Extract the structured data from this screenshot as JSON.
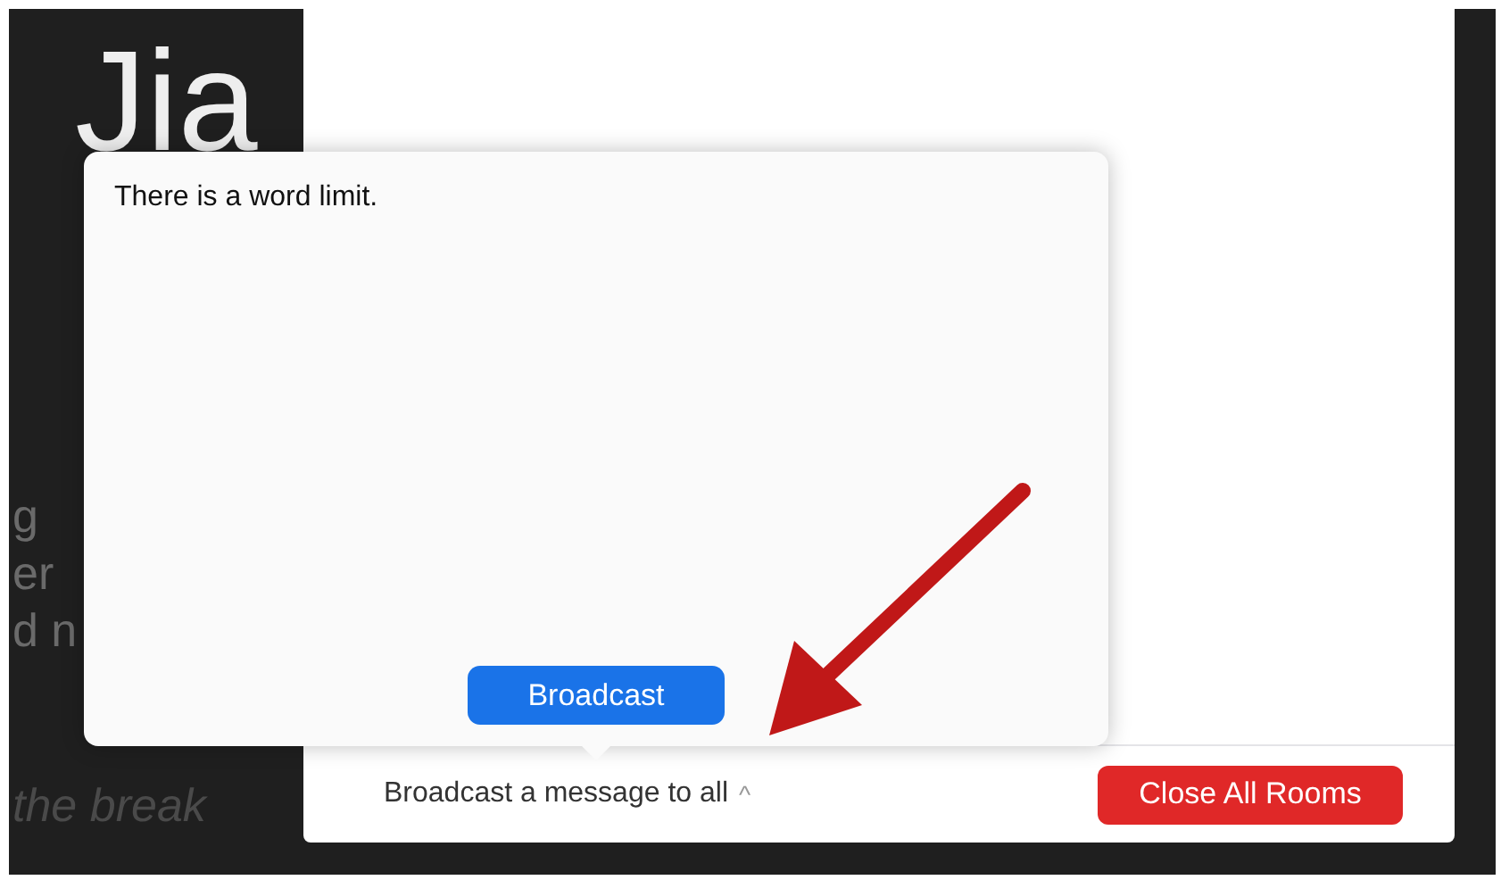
{
  "background_texts": [
    {
      "kind": "heading",
      "text": "Jia"
    },
    {
      "kind": "line",
      "text": "g"
    },
    {
      "kind": "line",
      "text": "er"
    },
    {
      "kind": "line",
      "text": "d n"
    },
    {
      "kind": "italic",
      "text": "the break"
    }
  ],
  "popover": {
    "message": "There is a word limit.",
    "button": "Broadcast"
  },
  "bottom_bar": {
    "label": "Broadcast a message to all",
    "caret": "^",
    "close_button": "Close All Rooms"
  }
}
